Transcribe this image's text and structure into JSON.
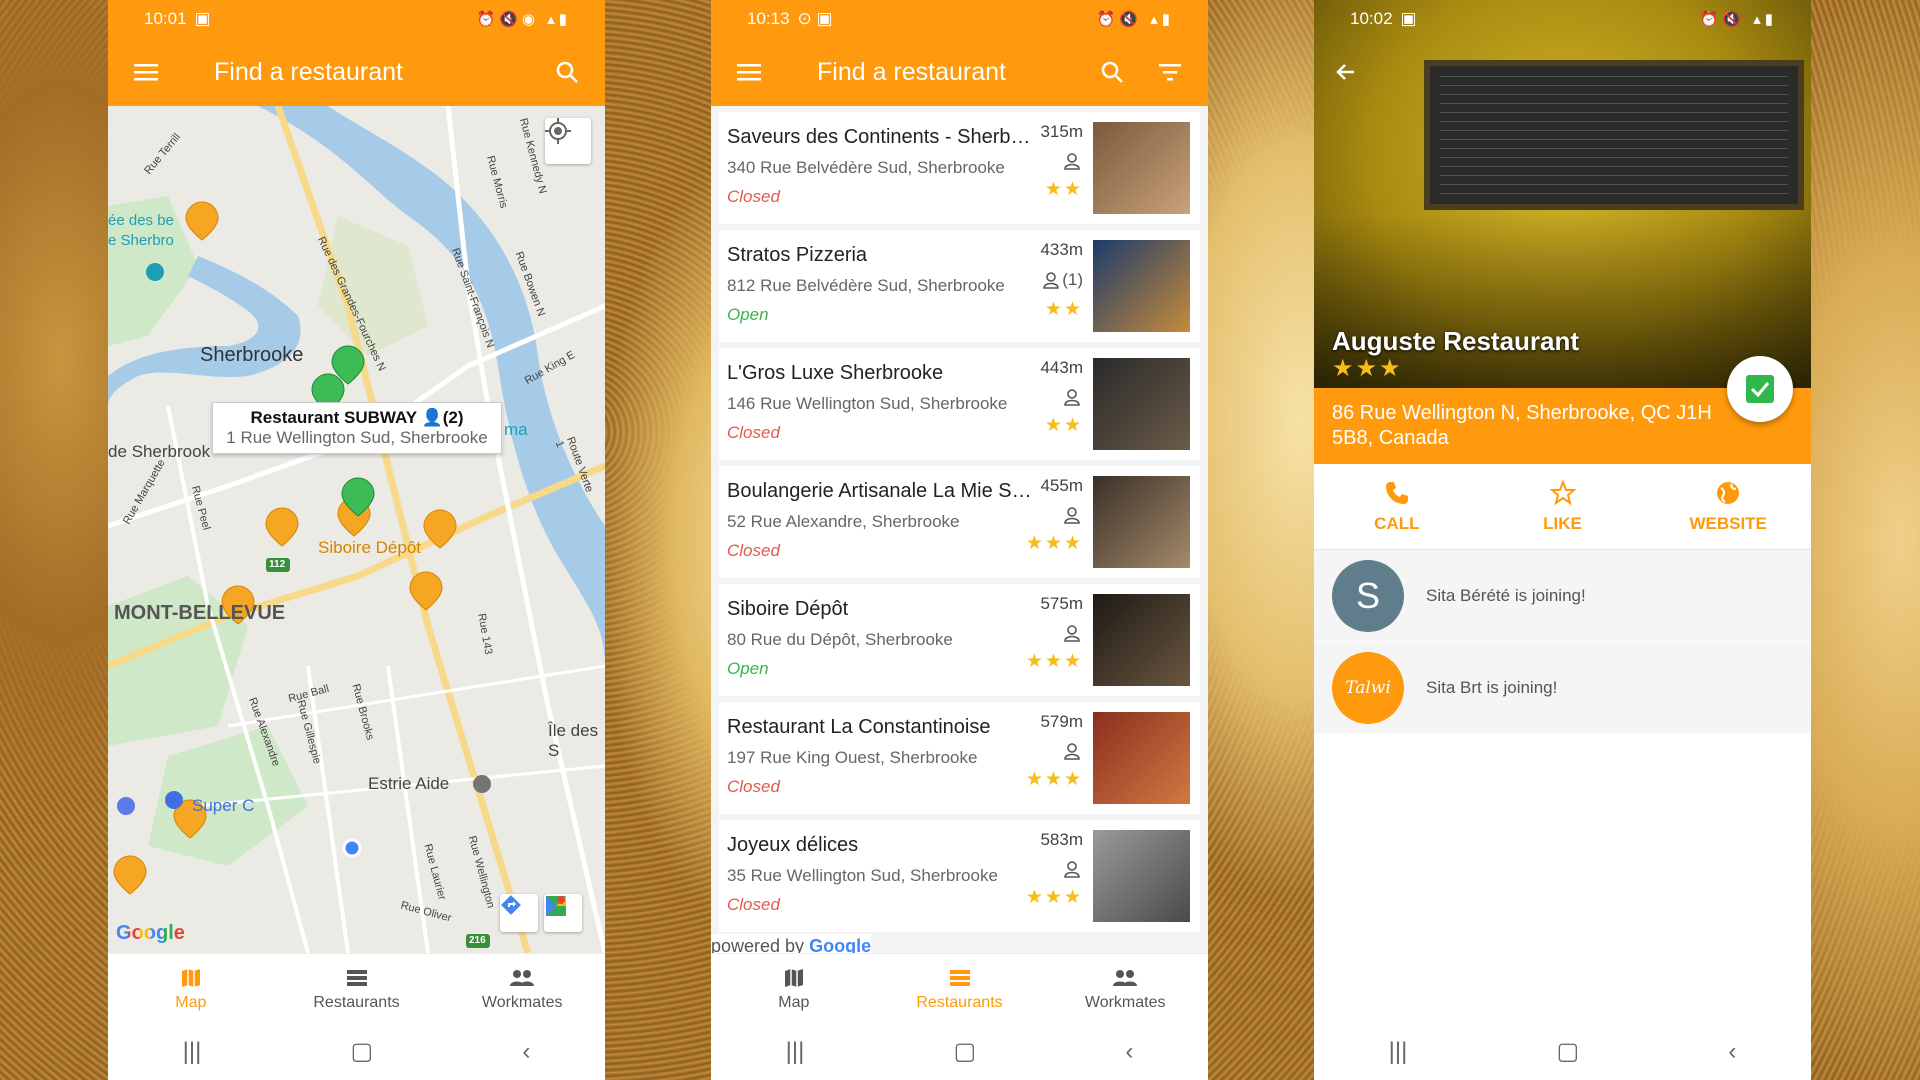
{
  "phone_map": {
    "status_time": "10:01",
    "title": "Find a restaurant",
    "map_labels": [
      "Sherbrooke",
      "MONT-BELLEVUE",
      "Siboire Dépôt",
      "Estrie Aide",
      "Super C",
      "Île des S",
      "de Sherbrook",
      "ée des be",
      "e Sherbro",
      "ma",
      "112",
      "216"
    ],
    "street_labels": [
      "Rue Terrill",
      "Rue des Grandes-Fourches N",
      "Rue Saint-François N",
      "Rue Bowen N",
      "Rue King E",
      "Route Verte 1",
      "Rue 143",
      "Rue Marquette",
      "Rue Peel",
      "Rue Alexandre",
      "Rue Gillespie",
      "Rue Brooks",
      "Rue Ball",
      "Rue Laurier",
      "Rue Oliver",
      "Rue Wellington",
      "Rue Kennedy N",
      "Rue Morris"
    ],
    "info_window": {
      "name": "Restaurant SUBWAY",
      "workmates": "(2)",
      "address": "1 Rue Wellington Sud, Sherbrooke"
    },
    "google_logo": "Google",
    "nav": {
      "map": "Map",
      "restaurants": "Restaurants",
      "workmates": "Workmates"
    }
  },
  "phone_list": {
    "status_time": "10:13",
    "title": "Find a restaurant",
    "restaurants": [
      {
        "name": "Saveurs des Continents - Sherbrooke",
        "address": "340 Rue Belvédère Sud, Sherbrooke",
        "status": "Closed",
        "distance": "315m",
        "workmates": "",
        "stars": "★★"
      },
      {
        "name": "Stratos Pizzeria",
        "address": "812 Rue Belvédère Sud, Sherbrooke",
        "status": "Open",
        "distance": "433m",
        "workmates": "(1)",
        "stars": "★★"
      },
      {
        "name": "L'Gros Luxe Sherbrooke",
        "address": "146 Rue Wellington Sud, Sherbrooke",
        "status": "Closed",
        "distance": "443m",
        "workmates": "",
        "stars": "★★"
      },
      {
        "name": "Boulangerie Artisanale La Mie Sherbrooke",
        "address": "52 Rue Alexandre, Sherbrooke",
        "status": "Closed",
        "distance": "455m",
        "workmates": "",
        "stars": "★★★"
      },
      {
        "name": "Siboire Dépôt",
        "address": "80 Rue du Dépôt, Sherbrooke",
        "status": "Open",
        "distance": "575m",
        "workmates": "",
        "stars": "★★★"
      },
      {
        "name": "Restaurant La Constantinoise",
        "address": "197 Rue King Ouest, Sherbrooke",
        "status": "Closed",
        "distance": "579m",
        "workmates": "",
        "stars": "★★★"
      },
      {
        "name": "Joyeux délices",
        "address": "35 Rue Wellington Sud, Sherbrooke",
        "status": "Closed",
        "distance": "583m",
        "workmates": "",
        "stars": "★★★"
      }
    ],
    "powered_by": "powered by",
    "powered_brand": "Google",
    "nav": {
      "map": "Map",
      "restaurants": "Restaurants",
      "workmates": "Workmates"
    }
  },
  "phone_detail": {
    "status_time": "10:02",
    "name": "Auguste Restaurant",
    "stars": "★★★",
    "address": "86 Rue Wellington N, Sherbrooke, QC J1H 5B8, Canada",
    "actions": {
      "call": "CALL",
      "like": "LIKE",
      "website": "WEBSITE"
    },
    "joiners": [
      {
        "initial": "S",
        "text": "Sita Bérété is joining!",
        "color": "#607d8b"
      },
      {
        "initial": "Talwi",
        "text": "Sita Brt is joining!",
        "color": "#ff9a0e"
      }
    ]
  },
  "colors": {
    "accent": "#ff9a0e",
    "star": "#f5bd17",
    "open": "#3cb44b",
    "closed": "#e05a4a"
  }
}
